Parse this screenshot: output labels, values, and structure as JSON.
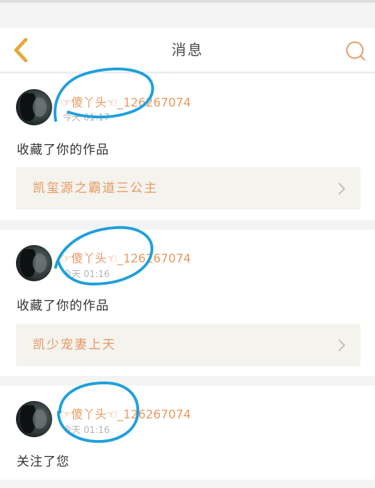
{
  "header": {
    "title": "消息",
    "back_icon": "chevron-left-icon",
    "search_icon": "search-icon"
  },
  "colors": {
    "accent": "#e79a63",
    "annotation": "#1fa0dc",
    "card_bg": "#ffffff",
    "page_bg": "#f3f3f3",
    "link_bg": "#f4f3ee"
  },
  "notifications": [
    {
      "username": "☞傻丫头☜_126267074",
      "time": "今天 01:17",
      "message": "收藏了你的作品",
      "work_title": "凯玺源之霸道三公主"
    },
    {
      "username": "☞傻丫头☜_126267074",
      "time": "今天 01:16",
      "message": "收藏了你的作品",
      "work_title": "凯少宠妻上天"
    },
    {
      "username": "☞傻丫头☜_126267074",
      "time": "今天 01:16",
      "message": "关注了您"
    }
  ]
}
